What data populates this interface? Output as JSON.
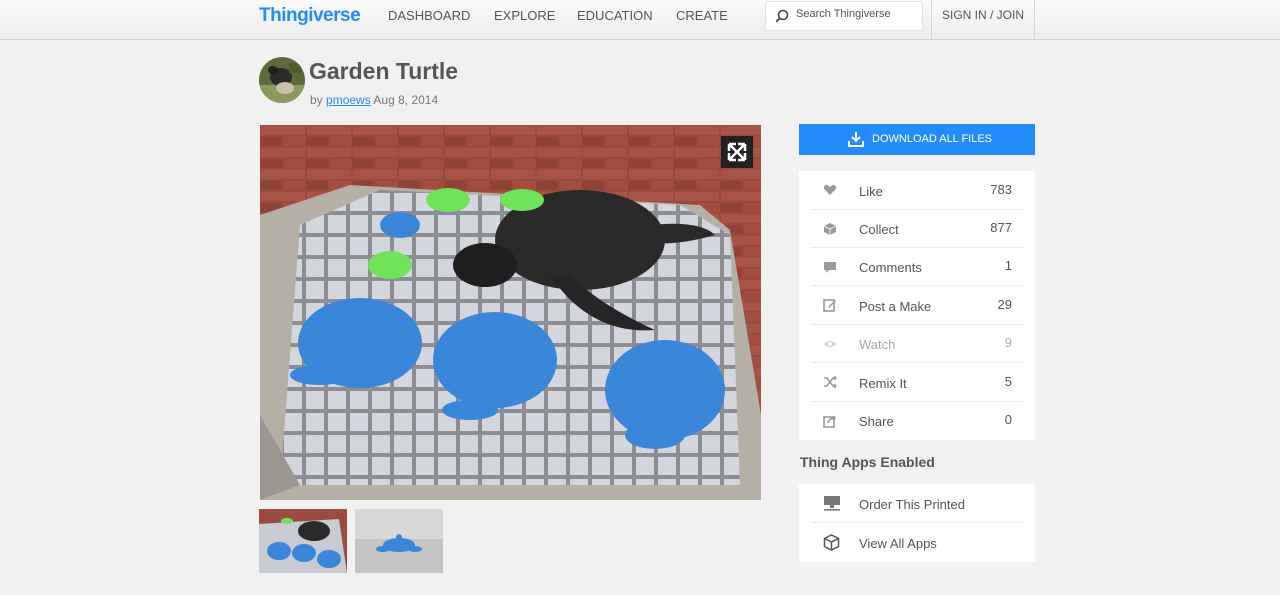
{
  "nav": {
    "logo": "Thingiverse",
    "links": [
      "DASHBOARD",
      "EXPLORE",
      "EDUCATION",
      "CREATE"
    ],
    "search_placeholder": "Search Thingiverse",
    "signin": "SIGN IN / JOIN"
  },
  "thing": {
    "title": "Garden Turtle",
    "by": "by",
    "author": "pmoews",
    "date": "Aug 8, 2014"
  },
  "sidebar": {
    "download_label": "DOWNLOAD ALL FILES",
    "actions": [
      {
        "label": "Like",
        "count": "783",
        "icon": "heart-icon"
      },
      {
        "label": "Collect",
        "count": "877",
        "icon": "collect-icon"
      },
      {
        "label": "Comments",
        "count": "1",
        "icon": "comment-icon"
      },
      {
        "label": "Post a Make",
        "count": "29",
        "icon": "edit-icon"
      },
      {
        "label": "Watch",
        "count": "9",
        "icon": "eye-icon"
      },
      {
        "label": "Remix It",
        "count": "5",
        "icon": "shuffle-icon"
      },
      {
        "label": "Share",
        "count": "0",
        "icon": "share-icon"
      }
    ],
    "apps_heading": "Thing Apps Enabled",
    "apps": [
      {
        "label": "Order This Printed",
        "icon": "printer-icon"
      },
      {
        "label": "View All Apps",
        "icon": "cube-icon"
      }
    ]
  },
  "colors": {
    "accent": "#248bfb",
    "background": "#f1f1f1",
    "icon_gray": "#9a9a9a"
  }
}
